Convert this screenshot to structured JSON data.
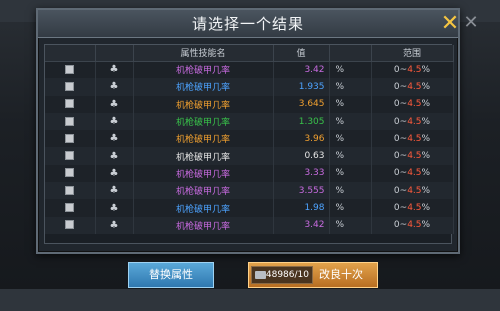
{
  "dialog": {
    "title": "请选择一个结果"
  },
  "table": {
    "headers": [
      "",
      "",
      "属性技能名",
      "值",
      "",
      "范围"
    ],
    "rows": [
      {
        "name": "机枪破甲几率",
        "value": "3.42",
        "unit": "%",
        "range_low": "0~",
        "range_high": "4.5",
        "range_unit": "%",
        "color": "#c86be0"
      },
      {
        "name": "机枪破甲几率",
        "value": "1.935",
        "unit": "%",
        "range_low": "0~",
        "range_high": "4.5",
        "range_unit": "%",
        "color": "#4da3ff"
      },
      {
        "name": "机枪破甲几率",
        "value": "3.645",
        "unit": "%",
        "range_low": "0~",
        "range_high": "4.5",
        "range_unit": "%",
        "color": "#f0a030"
      },
      {
        "name": "机枪破甲几率",
        "value": "1.305",
        "unit": "%",
        "range_low": "0~",
        "range_high": "4.5",
        "range_unit": "%",
        "color": "#39c24a"
      },
      {
        "name": "机枪破甲几率",
        "value": "3.96",
        "unit": "%",
        "range_low": "0~",
        "range_high": "4.5",
        "range_unit": "%",
        "color": "#f0a030"
      },
      {
        "name": "机枪破甲几率",
        "value": "0.63",
        "unit": "%",
        "range_low": "0~",
        "range_high": "4.5",
        "range_unit": "%",
        "color": "#e6e6e6"
      },
      {
        "name": "机枪破甲几率",
        "value": "3.33",
        "unit": "%",
        "range_low": "0~",
        "range_high": "4.5",
        "range_unit": "%",
        "color": "#c86be0"
      },
      {
        "name": "机枪破甲几率",
        "value": "3.555",
        "unit": "%",
        "range_low": "0~",
        "range_high": "4.5",
        "range_unit": "%",
        "color": "#c86be0"
      },
      {
        "name": "机枪破甲几率",
        "value": "1.98",
        "unit": "%",
        "range_low": "0~",
        "range_high": "4.5",
        "range_unit": "%",
        "color": "#4da3ff"
      },
      {
        "name": "机枪破甲几率",
        "value": "3.42",
        "unit": "%",
        "range_low": "0~",
        "range_high": "4.5",
        "range_unit": "%",
        "color": "#c86be0"
      }
    ]
  },
  "buttons": {
    "replace_label": "替换属性",
    "reform_label": "改良十次",
    "cost": "48986/10"
  },
  "icons": {
    "close": "close-icon",
    "lock": "lock-icon",
    "cost": "equipment-part-icon"
  }
}
